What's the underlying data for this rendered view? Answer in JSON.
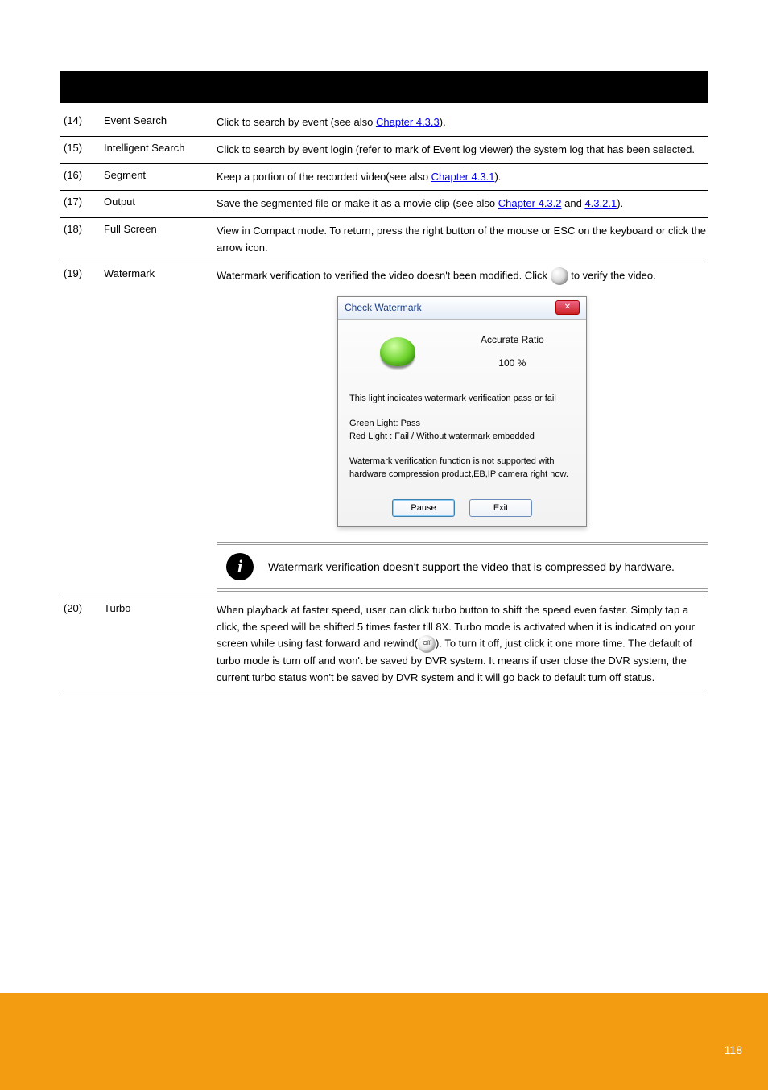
{
  "rows": [
    {
      "num": "(14)",
      "title": "Event Search",
      "desc_before": "Click to search by event (see also ",
      "link": "Chapter 4.3.3",
      "desc_after": ")."
    },
    {
      "num": "(15)",
      "title": "Intelligent Search",
      "desc": "Click to search by event login (refer to mark of Event log viewer) the system log that has been selected."
    },
    {
      "num": "(16)",
      "title": "Segment",
      "desc_before": "Keep a portion of the recorded video(see also ",
      "link": "Chapter 4.3.1",
      "desc_after": ")."
    },
    {
      "num": "(17)",
      "title": "Output",
      "desc_before": "Save the segmented file or make it as a movie clip (see also ",
      "link1": "Chapter 4.3.2",
      "desc_mid": " and ",
      "link2": "4.3.2.1",
      "desc_after": ")."
    },
    {
      "num": "(18)",
      "title": "Full Screen",
      "desc": "View in Compact mode. To return, press the right button of the mouse or ESC on the keyboard or click the arrow icon."
    }
  ],
  "row_wm": {
    "num": "(19)",
    "title": "Watermark",
    "lead": "Watermark verification to verified the ",
    "tail": "video doesn't been modified. Click ",
    "after_icon": " to verify the video."
  },
  "dialog": {
    "title": "Check Watermark",
    "ratio_label": "Accurate Ratio",
    "ratio_value": "100 %",
    "line1": "This light indicates watermark verification pass or fail",
    "line2": "Green Light:  Pass",
    "line3": "Red Light  :  Fail / Without watermark embedded",
    "line4": "Watermark verification function is not supported with hardware compression product,EB,IP camera right now.",
    "pause": "Pause",
    "exit": "Exit"
  },
  "note": "Watermark verification doesn't support the video that is compressed by hardware.",
  "turbo": {
    "num": "(20)",
    "title": "Turbo",
    "p1": "When playback at faster speed, user can click turbo button to shift the speed even faster. Simply tap a click, the speed will be shifted 5 times faster till 8X. Turbo mode is activated when it is indicated on your screen while using fast forward and rewind(",
    "p2_after_icon": "). To turn it off, just click it one more time. The default of turbo mode is turn off and won't be saved by DVR system. It means if user close the DVR ",
    "p3": "system, the current turbo status won't be saved by DVR system and it will go back to default turn off status."
  },
  "page_number": "118"
}
